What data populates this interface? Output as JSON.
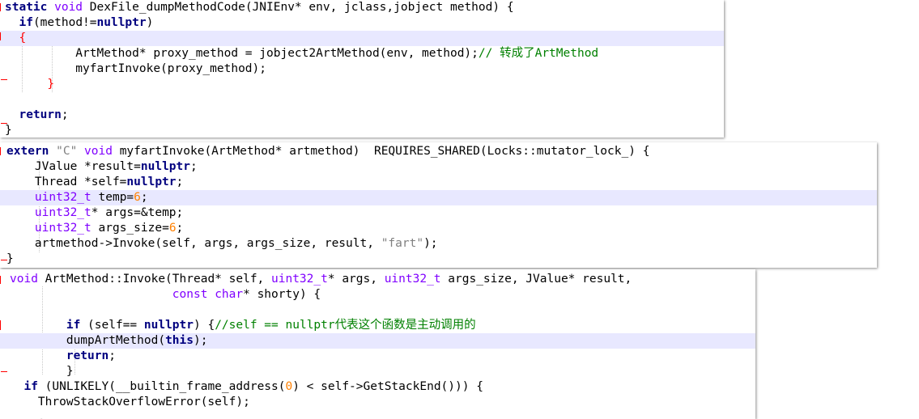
{
  "panels": [
    {
      "name": "dexfile-dump-method-code",
      "lines": [
        [
          {
            "t": "static ",
            "c": "k"
          },
          {
            "t": "void ",
            "c": "t"
          },
          {
            "t": "DexFile_dumpMethodCode(JNIEnv* env, jclass,jobject method) {"
          }
        ],
        [
          {
            "t": "  "
          },
          {
            "t": "if",
            "c": "k"
          },
          {
            "t": "(method!="
          },
          {
            "t": "nullptr",
            "c": "k"
          },
          {
            "t": ")"
          }
        ],
        [
          {
            "t": "  "
          },
          {
            "t": "{",
            "c": "red"
          }
        ],
        [
          {
            "t": "          ArtMethod* proxy_method = jobject2ArtMethod(env, method);"
          },
          {
            "t": "// 转成了ArtMethod",
            "c": "c"
          }
        ],
        [
          {
            "t": "          myfartInvoke(proxy_method);"
          }
        ],
        [
          {
            "t": "      "
          },
          {
            "t": "}",
            "c": "red"
          }
        ],
        [
          {
            "t": ""
          }
        ],
        [
          {
            "t": "  "
          },
          {
            "t": "return",
            "c": "k"
          },
          {
            "t": ";"
          }
        ],
        [
          {
            "t": "}"
          }
        ]
      ]
    },
    {
      "name": "myfart-invoke",
      "lines": [
        [
          {
            "t": "extern ",
            "c": "k"
          },
          {
            "t": "\"C\" ",
            "c": "s"
          },
          {
            "t": "void ",
            "c": "t"
          },
          {
            "t": "myfartInvoke(ArtMethod* artmethod)  REQUIRES_SHARED(Locks::mutator_lock_) {"
          }
        ],
        [
          {
            "t": "    JValue *result="
          },
          {
            "t": "nullptr",
            "c": "k"
          },
          {
            "t": ";"
          }
        ],
        [
          {
            "t": "    Thread *self="
          },
          {
            "t": "nullptr",
            "c": "k"
          },
          {
            "t": ";"
          }
        ],
        [
          {
            "t": "    "
          },
          {
            "t": "uint32_t ",
            "c": "t"
          },
          {
            "t": "temp="
          },
          {
            "t": "6",
            "c": "n"
          },
          {
            "t": ";"
          }
        ],
        [
          {
            "t": "    "
          },
          {
            "t": "uint32_t",
            "c": "t"
          },
          {
            "t": "* args=&temp;"
          }
        ],
        [
          {
            "t": "    "
          },
          {
            "t": "uint32_t ",
            "c": "t"
          },
          {
            "t": "args_size="
          },
          {
            "t": "6",
            "c": "n"
          },
          {
            "t": ";"
          }
        ],
        [
          {
            "t": "    artmethod->Invoke(self, args, args_size, result, "
          },
          {
            "t": "\"fart\"",
            "c": "s"
          },
          {
            "t": ");"
          }
        ],
        [
          {
            "t": "}"
          }
        ]
      ]
    },
    {
      "name": "artmethod-invoke",
      "lines": [
        [
          {
            "t": "void ",
            "c": "t"
          },
          {
            "t": "ArtMethod::Invoke(Thread* self, "
          },
          {
            "t": "uint32_t",
            "c": "t"
          },
          {
            "t": "* args, "
          },
          {
            "t": "uint32_t ",
            "c": "t"
          },
          {
            "t": "args_size, JValue* result,"
          }
        ],
        [
          {
            "t": "                       "
          },
          {
            "t": "const ",
            "c": "t"
          },
          {
            "t": "char",
            "c": "t"
          },
          {
            "t": "* shorty) {"
          }
        ],
        [
          {
            "t": ""
          }
        ],
        [
          {
            "t": "        "
          },
          {
            "t": "if ",
            "c": "k"
          },
          {
            "t": "(self== "
          },
          {
            "t": "nullptr",
            "c": "k"
          },
          {
            "t": ") {"
          },
          {
            "t": "//self == nullptr代表这个函数是主动调用的",
            "c": "c"
          }
        ],
        [
          {
            "t": "        dumpArtMethod("
          },
          {
            "t": "this",
            "c": "k"
          },
          {
            "t": ");"
          }
        ],
        [
          {
            "t": "        "
          },
          {
            "t": "return",
            "c": "k"
          },
          {
            "t": ";"
          }
        ],
        [
          {
            "t": "        }"
          }
        ],
        [
          {
            "t": "  "
          },
          {
            "t": "if ",
            "c": "k"
          },
          {
            "t": "(UNLIKELY(__builtin_frame_address("
          },
          {
            "t": "0",
            "c": "n"
          },
          {
            "t": ") < self->GetStackEnd())) {"
          }
        ],
        [
          {
            "t": "    ThrowStackOverflowError(self);"
          }
        ],
        [
          {
            "t": "    "
          },
          {
            "t": "."
          }
        ]
      ]
    }
  ]
}
